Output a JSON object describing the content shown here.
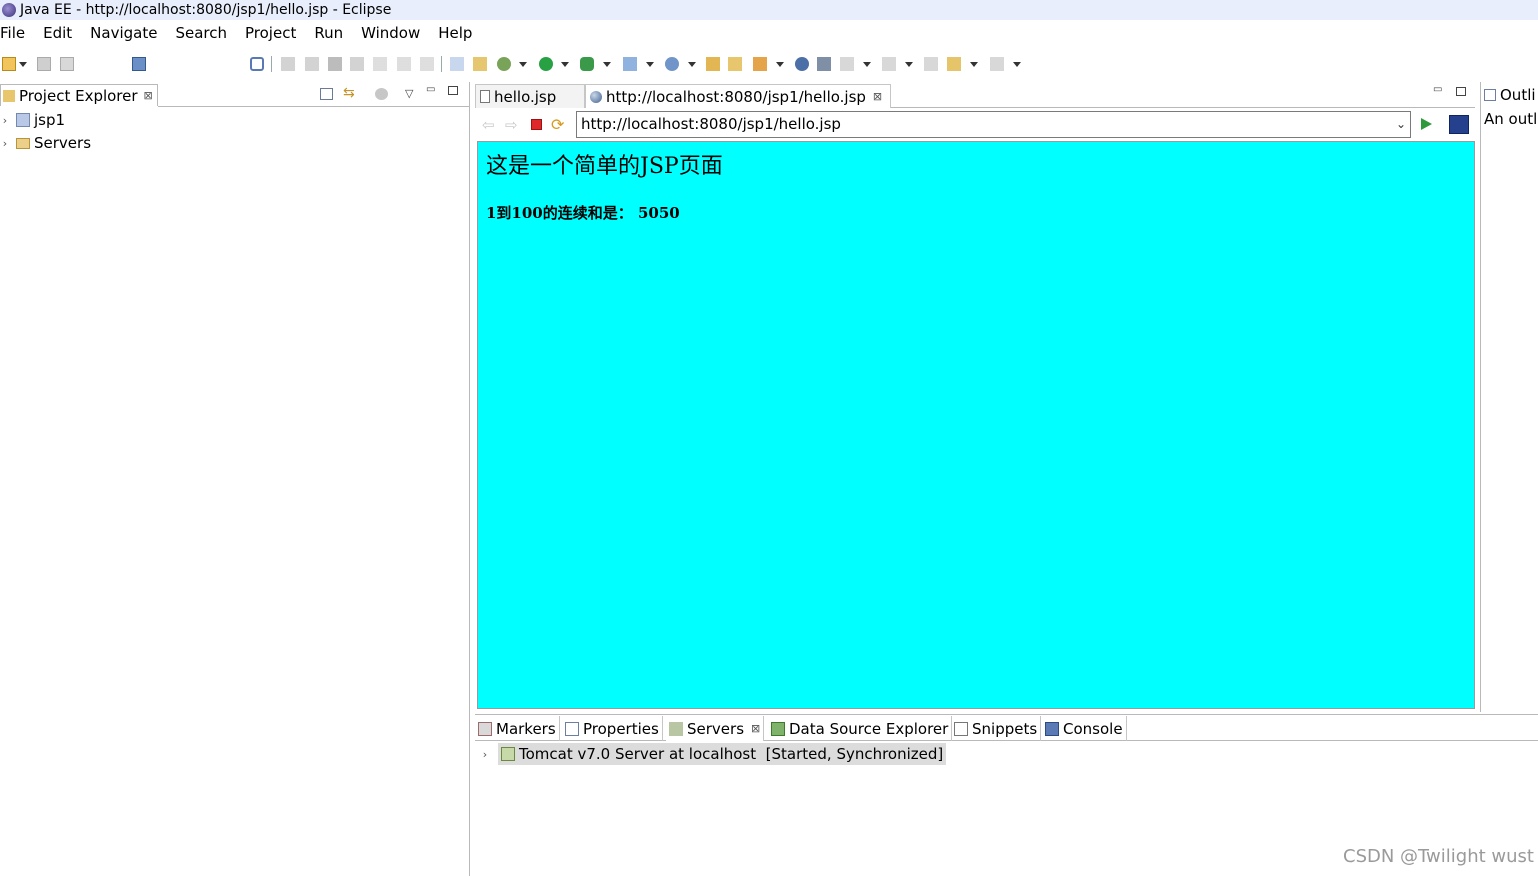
{
  "window": {
    "title": "Java EE - http://localhost:8080/jsp1/hello.jsp - Eclipse"
  },
  "menu": [
    "File",
    "Edit",
    "Navigate",
    "Search",
    "Project",
    "Run",
    "Window",
    "Help"
  ],
  "project_explorer": {
    "tab_label": "Project Explorer",
    "items": [
      {
        "label": "jsp1",
        "icon": "project-icon"
      },
      {
        "label": "Servers",
        "icon": "folder-icon"
      }
    ]
  },
  "editor": {
    "tabs": [
      {
        "label": "hello.jsp",
        "icon": "file-icon"
      },
      {
        "label": "http://localhost:8080/jsp1/hello.jsp",
        "icon": "globe-icon"
      }
    ],
    "url": "http://localhost:8080/jsp1/hello.jsp",
    "page": {
      "heading": "这是一个简单的JSP页面",
      "result": "1到100的连续和是： 5050",
      "background": "#00ffff"
    }
  },
  "outline": {
    "tab_label": "Outli",
    "text": "An outl"
  },
  "bottom_panel": {
    "tabs": [
      "Markers",
      "Properties",
      "Servers",
      "Data Source Explorer",
      "Snippets",
      "Console"
    ],
    "server": "Tomcat v7.0 Server at localhost  [Started, Synchronized]"
  },
  "watermark": "CSDN @Twilight wust"
}
